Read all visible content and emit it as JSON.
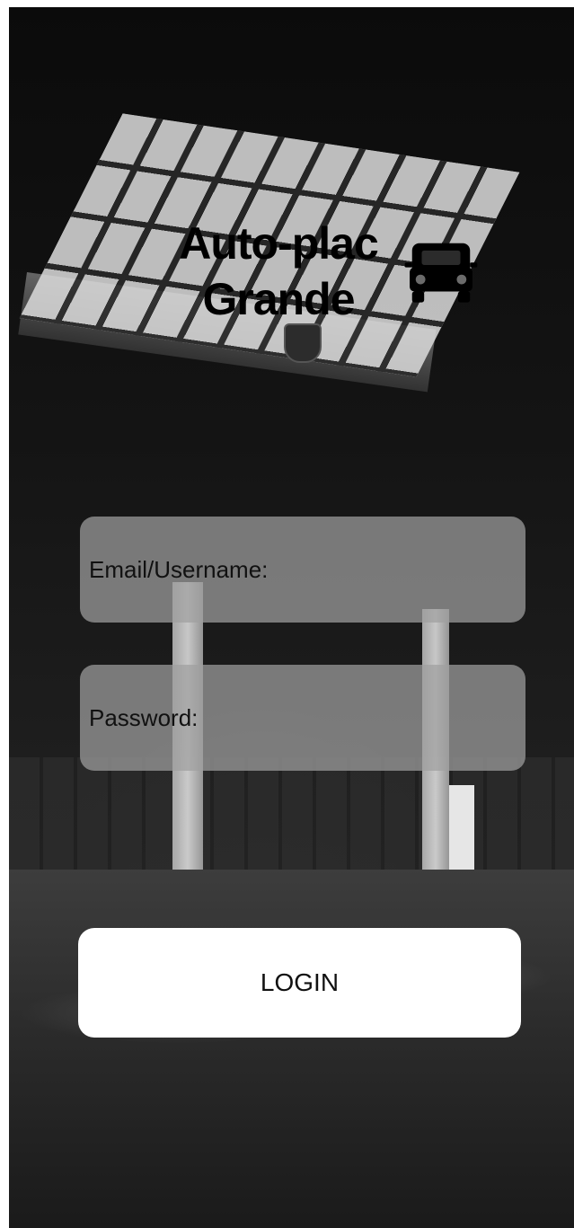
{
  "brand": {
    "title": "Auto-plac\nGrande",
    "icon": "car-icon"
  },
  "form": {
    "email": {
      "placeholder": "Email/Username:",
      "value": ""
    },
    "password": {
      "placeholder": "Password:",
      "value": ""
    },
    "login_label": "LOGIN"
  },
  "colors": {
    "field_background": "#a0a0a0",
    "button_background": "#ffffff",
    "text": "#111111"
  }
}
